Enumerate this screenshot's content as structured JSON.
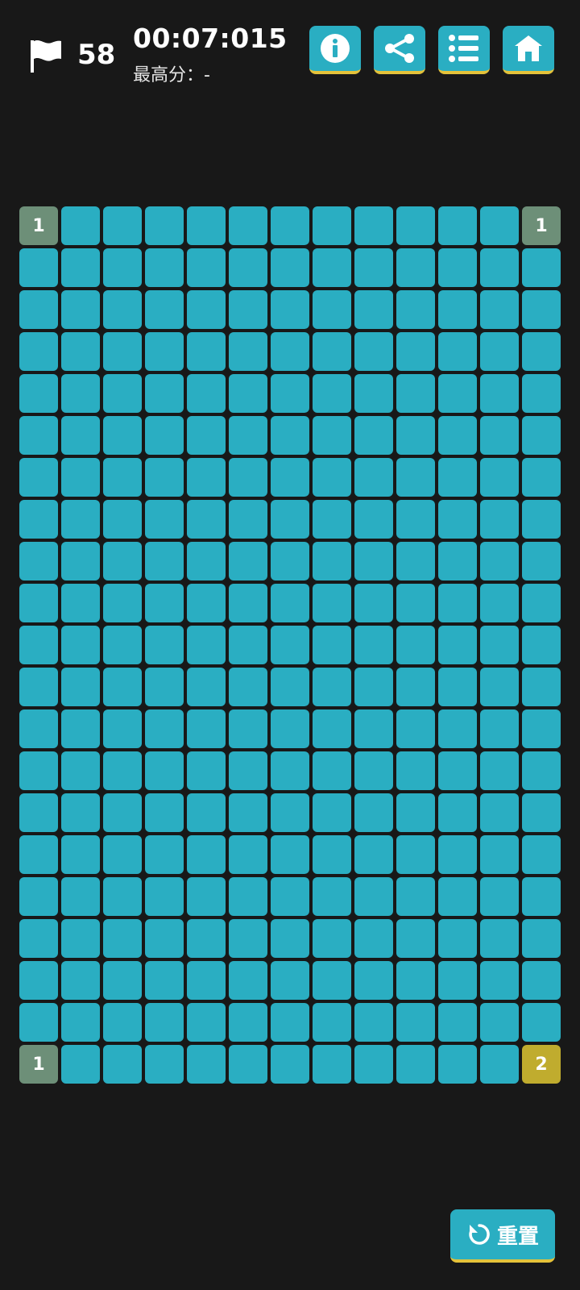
{
  "header": {
    "flag_count": "58",
    "timer": "00:07:015",
    "best_score": "最高分：-"
  },
  "buttons": {
    "info_icon": "info-icon",
    "share_icon": "share-icon",
    "list_icon": "list-icon",
    "home_icon": "home-icon",
    "reset_label": "重置",
    "reset_icon": "refresh-icon"
  },
  "board": {
    "rows": 21,
    "cols": 13,
    "revealed": [
      {
        "row": 0,
        "col": 0,
        "value": "1"
      },
      {
        "row": 0,
        "col": 12,
        "value": "1"
      },
      {
        "row": 20,
        "col": 0,
        "value": "1"
      },
      {
        "row": 20,
        "col": 12,
        "value": "2"
      }
    ]
  },
  "colors": {
    "background": "#181818",
    "tile": "#2aaec2",
    "revealed_tile": "#6d8f78",
    "revealed_tile_two": "#c0ac2e",
    "button_accent": "#e4c23a"
  }
}
